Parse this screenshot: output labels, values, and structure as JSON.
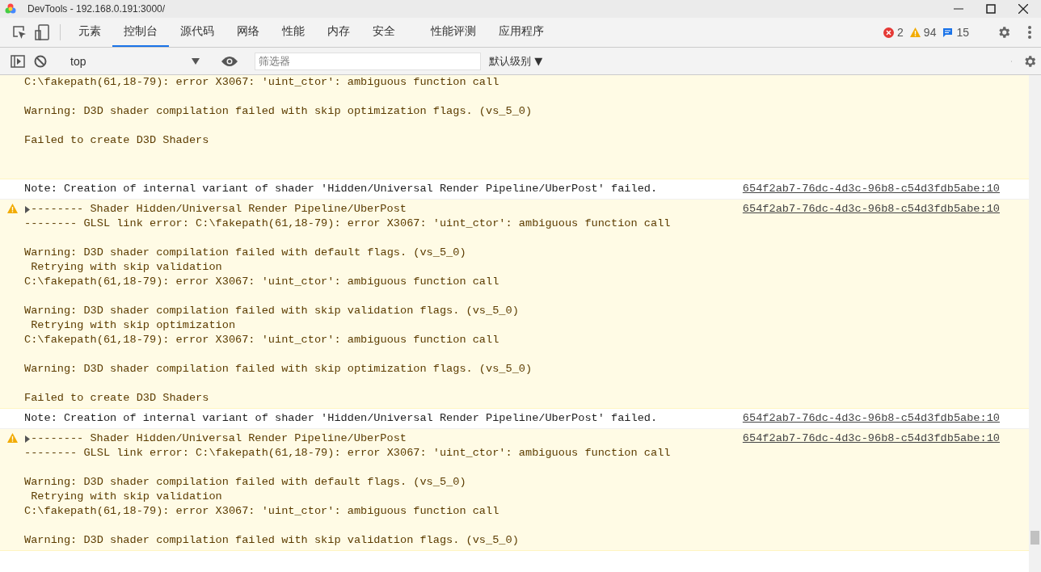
{
  "window": {
    "title": "DevTools - 192.168.0.191:3000/"
  },
  "tabs": [
    {
      "label": "元素",
      "selected": false
    },
    {
      "label": "控制台",
      "selected": true
    },
    {
      "label": "源代码",
      "selected": false
    },
    {
      "label": "网络",
      "selected": false
    },
    {
      "label": "性能",
      "selected": false
    },
    {
      "label": "内存",
      "selected": false
    },
    {
      "label": "安全",
      "selected": false
    },
    {
      "label": "性能评测",
      "selected": false
    },
    {
      "label": "应用程序",
      "selected": false
    }
  ],
  "counters": {
    "errors": "2",
    "warnings": "94",
    "info": "15"
  },
  "toolbar": {
    "context": "top",
    "filter": {
      "placeholder": "筛选器"
    },
    "level": "默认级别 ▼"
  },
  "messages": [
    {
      "kind": "warning",
      "text": "C:\\fakepath(61,18-79): error X3067: 'uint_ctor': ambiguous function call\n\nWarning: D3D shader compilation failed with skip optimization flags. (vs_5_0)\n\nFailed to create D3D Shaders"
    },
    {
      "kind": "note",
      "text": "Note: Creation of internal variant of shader 'Hidden/Universal Render Pipeline/UberPost' failed.",
      "source": "654f2ab7-76dc-4d3c-96b8-c54d3fdb5abe:10"
    },
    {
      "kind": "warning",
      "summary": "-------- Shader Hidden/Universal Render Pipeline/UberPost",
      "text": "-------- GLSL link error: C:\\fakepath(61,18-79): error X3067: 'uint_ctor': ambiguous function call\n\nWarning: D3D shader compilation failed with default flags. (vs_5_0)\n Retrying with skip validation\nC:\\fakepath(61,18-79): error X3067: 'uint_ctor': ambiguous function call\n\nWarning: D3D shader compilation failed with skip validation flags. (vs_5_0)\n Retrying with skip optimization\nC:\\fakepath(61,18-79): error X3067: 'uint_ctor': ambiguous function call\n\nWarning: D3D shader compilation failed with skip optimization flags. (vs_5_0)\n\nFailed to create D3D Shaders",
      "source": "654f2ab7-76dc-4d3c-96b8-c54d3fdb5abe:10"
    },
    {
      "kind": "note",
      "text": "Note: Creation of internal variant of shader 'Hidden/Universal Render Pipeline/UberPost' failed.",
      "source": "654f2ab7-76dc-4d3c-96b8-c54d3fdb5abe:10"
    },
    {
      "kind": "warning",
      "summary": "-------- Shader Hidden/Universal Render Pipeline/UberPost",
      "text": "-------- GLSL link error: C:\\fakepath(61,18-79): error X3067: 'uint_ctor': ambiguous function call\n\nWarning: D3D shader compilation failed with default flags. (vs_5_0)\n Retrying with skip validation\nC:\\fakepath(61,18-79): error X3067: 'uint_ctor': ambiguous function call\n\nWarning: D3D shader compilation failed with skip validation flags. (vs_5_0)",
      "source": "654f2ab7-76dc-4d3c-96b8-c54d3fdb5abe:10"
    }
  ]
}
